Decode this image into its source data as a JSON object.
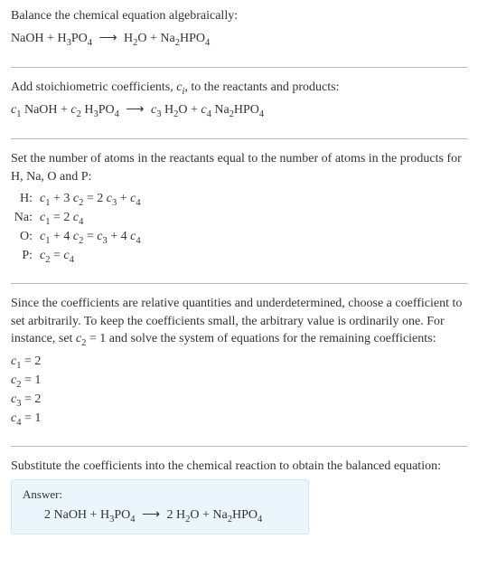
{
  "intro": {
    "title": "Balance the chemical equation algebraically:",
    "equation_html": "NaOH + H<sub>3</sub>PO<sub>4</sub> <span class='arrow'>⟶</span> H<sub>2</sub>O + Na<sub>2</sub>HPO<sub>4</sub>"
  },
  "step1": {
    "text_html": "Add stoichiometric coefficients, <span class='var'>c</span><span class='sub-i'>i</span>, to the reactants and products:",
    "equation_html": "<span class='var'>c</span><sub>1</sub> NaOH + <span class='var'>c</span><sub>2</sub> H<sub>3</sub>PO<sub>4</sub> <span class='arrow'>⟶</span> <span class='var'>c</span><sub>3</sub> H<sub>2</sub>O + <span class='var'>c</span><sub>4</sub> Na<sub>2</sub>HPO<sub>4</sub>"
  },
  "step2": {
    "text": "Set the number of atoms in the reactants equal to the number of atoms in the products for H, Na, O and P:",
    "rows": [
      {
        "label": "H:",
        "eq_html": "<span class='var'>c</span><sub>1</sub> + 3 <span class='var'>c</span><sub>2</sub> = 2 <span class='var'>c</span><sub>3</sub> + <span class='var'>c</span><sub>4</sub>"
      },
      {
        "label": "Na:",
        "eq_html": "<span class='var'>c</span><sub>1</sub> = 2 <span class='var'>c</span><sub>4</sub>"
      },
      {
        "label": "O:",
        "eq_html": "<span class='var'>c</span><sub>1</sub> + 4 <span class='var'>c</span><sub>2</sub> = <span class='var'>c</span><sub>3</sub> + 4 <span class='var'>c</span><sub>4</sub>"
      },
      {
        "label": "P:",
        "eq_html": "<span class='var'>c</span><sub>2</sub> = <span class='var'>c</span><sub>4</sub>"
      }
    ]
  },
  "step3": {
    "text_html": "Since the coefficients are relative quantities and underdetermined, choose a coefficient to set arbitrarily. To keep the coefficients small, the arbitrary value is ordinarily one. For instance, set <span class='var'>c</span><sub>2</sub> = 1 and solve the system of equations for the remaining coefficients:",
    "solutions": [
      {
        "html": "<span class='var'>c</span><sub>1</sub> = 2"
      },
      {
        "html": "<span class='var'>c</span><sub>2</sub> = 1"
      },
      {
        "html": "<span class='var'>c</span><sub>3</sub> = 2"
      },
      {
        "html": "<span class='var'>c</span><sub>4</sub> = 1"
      }
    ]
  },
  "step4": {
    "text": "Substitute the coefficients into the chemical reaction to obtain the balanced equation:"
  },
  "answer": {
    "label": "Answer:",
    "equation_html": "2 NaOH + H<sub>3</sub>PO<sub>4</sub> <span class='arrow'>⟶</span> 2 H<sub>2</sub>O + Na<sub>2</sub>HPO<sub>4</sub>"
  },
  "chart_data": {
    "type": "table",
    "title": "Balanced chemical equation coefficients",
    "reaction": "NaOH + H3PO4 -> H2O + Na2HPO4",
    "atom_balance": [
      {
        "element": "H",
        "equation": "c1 + 3 c2 = 2 c3 + c4"
      },
      {
        "element": "Na",
        "equation": "c1 = 2 c4"
      },
      {
        "element": "O",
        "equation": "c1 + 4 c2 = c3 + 4 c4"
      },
      {
        "element": "P",
        "equation": "c2 = c4"
      }
    ],
    "coefficients": {
      "c1": 2,
      "c2": 1,
      "c3": 2,
      "c4": 1
    },
    "balanced": "2 NaOH + H3PO4 -> 2 H2O + Na2HPO4"
  }
}
